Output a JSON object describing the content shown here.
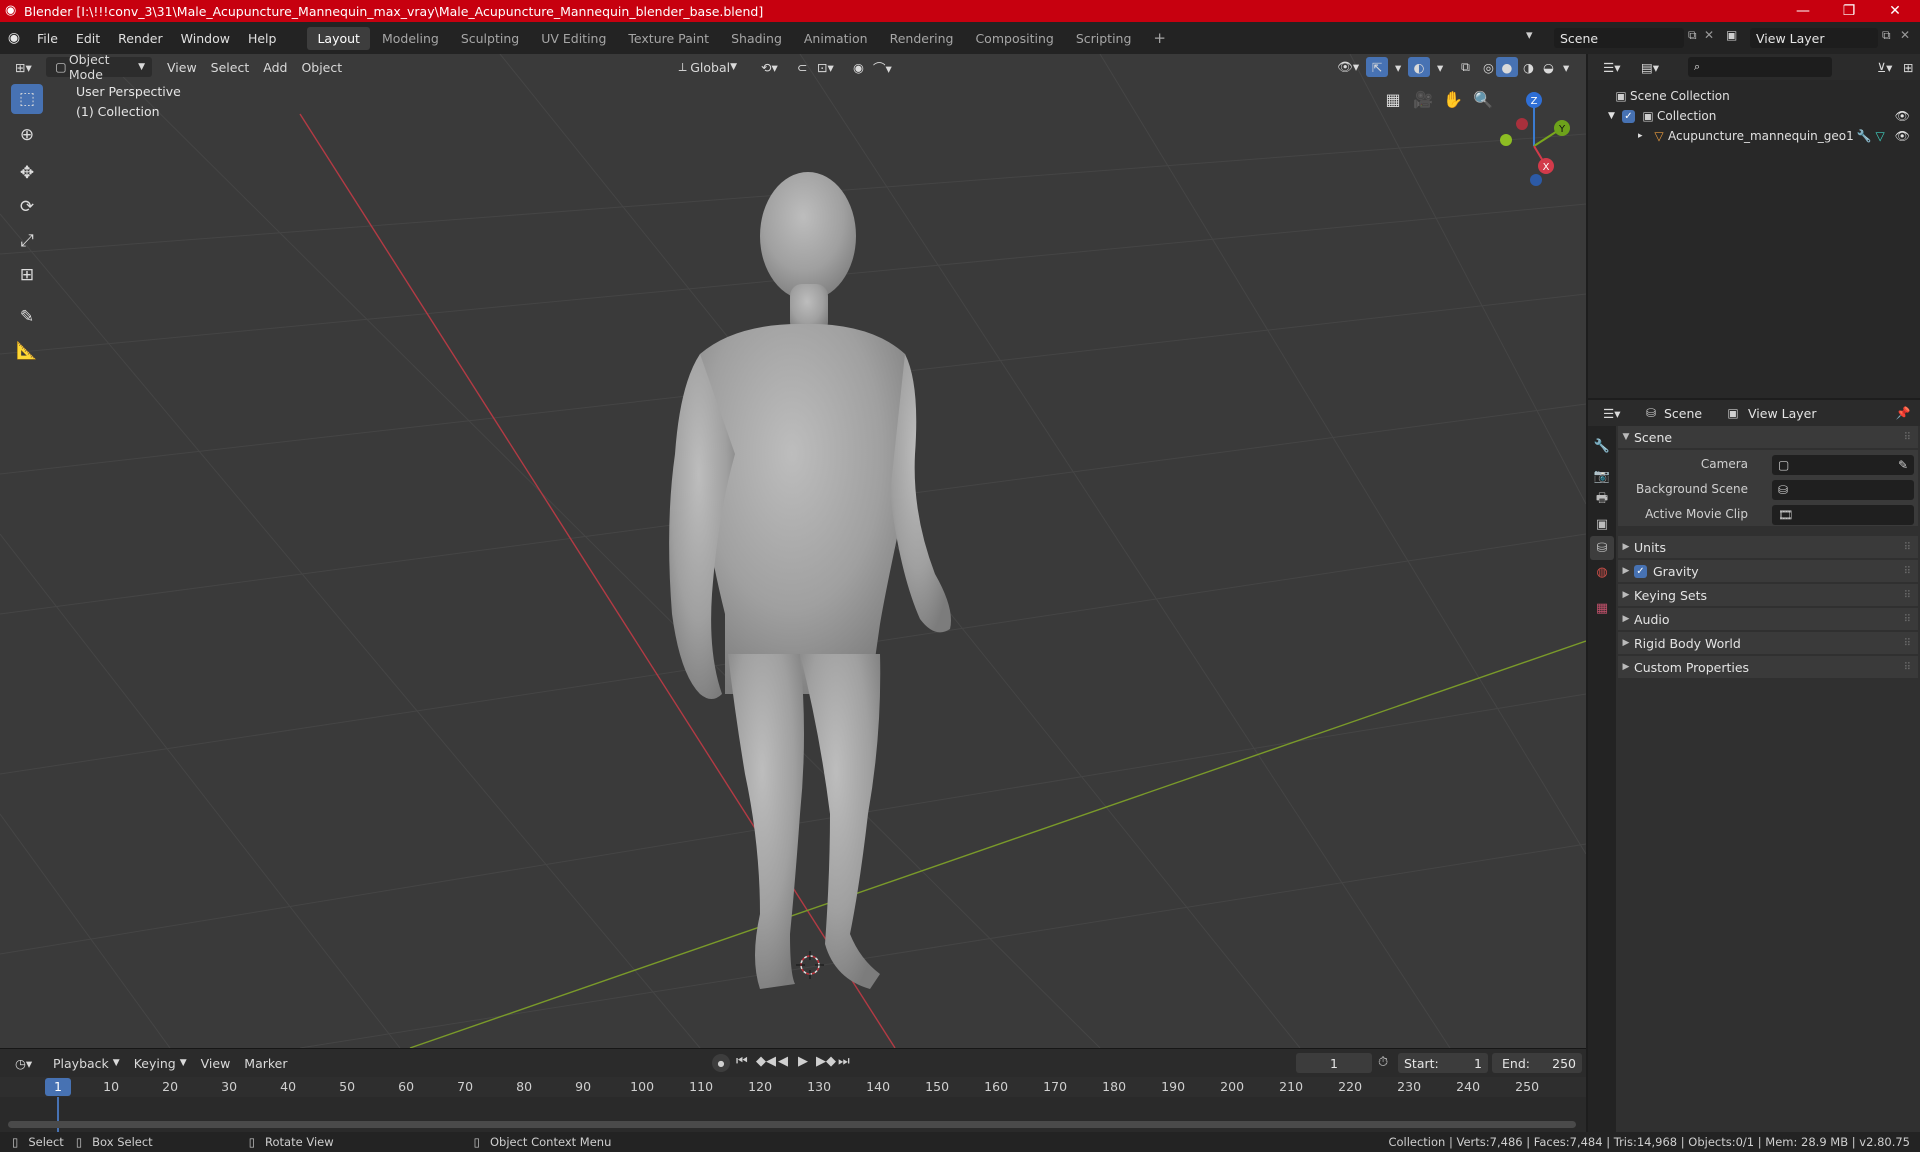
{
  "titlebar": {
    "title": "Blender [I:\\!!!conv_3\\31\\Male_Acupuncture_Mannequin_max_vray\\Male_Acupuncture_Mannequin_blender_base.blend]",
    "minimize": "—",
    "maximize": "❐",
    "close": "✕"
  },
  "menubar": {
    "menus": [
      "File",
      "Edit",
      "Render",
      "Window",
      "Help"
    ],
    "workspaces": [
      "Layout",
      "Modeling",
      "Sculpting",
      "UV Editing",
      "Texture Paint",
      "Shading",
      "Animation",
      "Rendering",
      "Compositing",
      "Scripting"
    ],
    "active_workspace": "Layout",
    "add_tab": "+",
    "scene": "Scene",
    "view_layer": "View Layer"
  },
  "viewport": {
    "mode": "Object Mode",
    "menus": [
      "View",
      "Select",
      "Add",
      "Object"
    ],
    "orientation": "Global",
    "overlay_title": "User Perspective",
    "overlay_collection": "(1) Collection",
    "gizmo": {
      "x": "X",
      "y": "Y",
      "z": "Z"
    }
  },
  "timeline": {
    "menus": [
      "Playback",
      "Keying",
      "View",
      "Marker"
    ],
    "current_frame": "1",
    "start_label": "Start:",
    "start": "1",
    "end_label": "End:",
    "end": "250",
    "ticks": [
      "10",
      "20",
      "30",
      "40",
      "50",
      "60",
      "70",
      "80",
      "90",
      "100",
      "110",
      "120",
      "130",
      "140",
      "150",
      "160",
      "170",
      "180",
      "190",
      "200",
      "210",
      "220",
      "230",
      "240",
      "250"
    ],
    "cursor_frame": "1"
  },
  "statusbar": {
    "select": "Select",
    "box_select": "Box Select",
    "rotate_view": "Rotate View",
    "context_menu": "Object Context Menu",
    "stats": "Collection | Verts:7,486 | Faces:7,484 | Tris:14,968 | Objects:0/1 | Mem: 28.9 MB | v2.80.75"
  },
  "outliner": {
    "scene_collection": "Scene Collection",
    "collection": "Collection",
    "object": "Acupuncture_mannequin_geo1"
  },
  "properties": {
    "tab_scene": "Scene",
    "tab_view_layer": "View Layer",
    "panel_title": "Scene",
    "camera_label": "Camera",
    "background_scene_label": "Background Scene",
    "active_movie_clip_label": "Active Movie Clip",
    "panels": [
      "Units",
      "Gravity",
      "Keying Sets",
      "Audio",
      "Rigid Body World",
      "Custom Properties"
    ]
  }
}
